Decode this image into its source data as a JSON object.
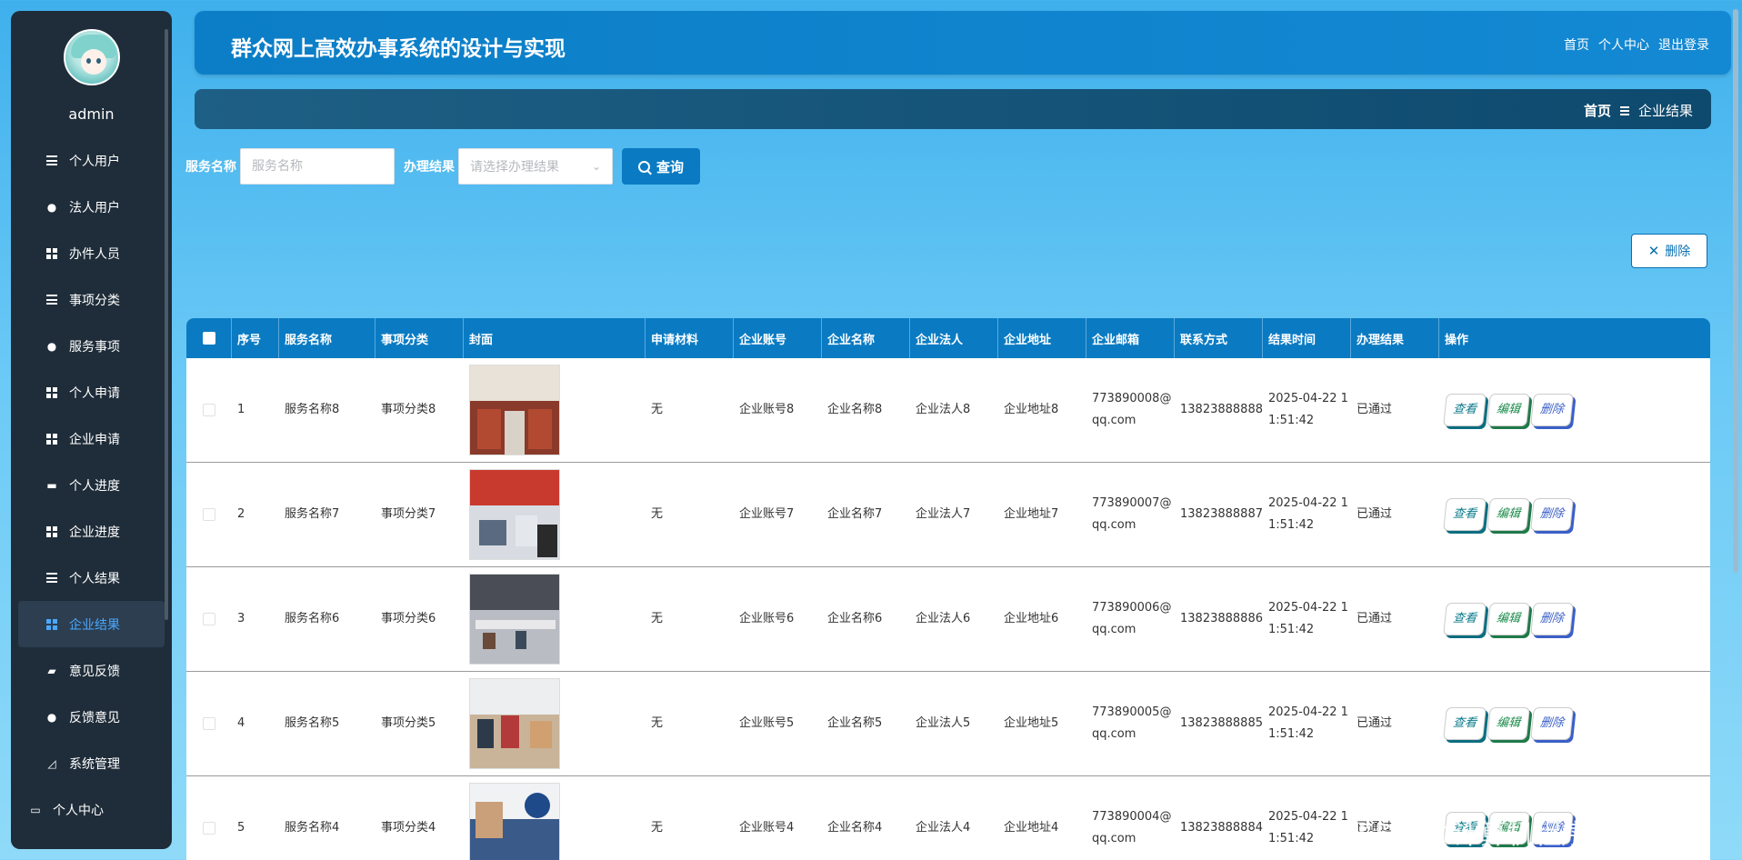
{
  "sidebar": {
    "username": "admin",
    "items": [
      {
        "label": "个人用户",
        "icon": "list-icon"
      },
      {
        "label": "法人用户",
        "icon": "user-icon"
      },
      {
        "label": "办件人员",
        "icon": "grid-icon"
      },
      {
        "label": "事项分类",
        "icon": "sliders-icon"
      },
      {
        "label": "服务事项",
        "icon": "user-icon"
      },
      {
        "label": "个人申请",
        "icon": "grid-icon"
      },
      {
        "label": "企业申请",
        "icon": "grid-icon"
      },
      {
        "label": "个人进度",
        "icon": "print-icon"
      },
      {
        "label": "企业进度",
        "icon": "grid-icon"
      },
      {
        "label": "个人结果",
        "icon": "list-icon"
      },
      {
        "label": "企业结果",
        "icon": "grid-icon"
      },
      {
        "label": "意见反馈",
        "icon": "ticket-icon"
      },
      {
        "label": "反馈意见",
        "icon": "bulb-icon"
      },
      {
        "label": "系统管理",
        "icon": "chart-icon"
      },
      {
        "label": "个人中心",
        "icon": "card-icon"
      }
    ],
    "active_index": 10
  },
  "header": {
    "title": "群众网上高效办事系统的设计与实现",
    "links": [
      "首页",
      "个人中心",
      "退出登录"
    ]
  },
  "breadcrumb": {
    "home": "首页",
    "current": "企业结果"
  },
  "search": {
    "name_label": "服务名称",
    "name_placeholder": "服务名称",
    "result_label": "办理结果",
    "result_placeholder": "请选择办理结果",
    "query_label": "查询"
  },
  "toolbar": {
    "delete_label": "删除"
  },
  "table": {
    "headers": [
      "序号",
      "服务名称",
      "事项分类",
      "封面",
      "申请材料",
      "企业账号",
      "企业名称",
      "企业法人",
      "企业地址",
      "企业邮箱",
      "联系方式",
      "结果时间",
      "办理结果",
      "操作"
    ],
    "rows": [
      {
        "idx": "1",
        "name": "服务名称8",
        "cat": "事项分类8",
        "mat": "无",
        "acct": "企业账号8",
        "cname": "企业名称8",
        "legal": "企业法人8",
        "addr": "企业地址8",
        "mail": "773890008@qq.com",
        "phone": "13823888888",
        "time": "2025-04-22 11:51:42",
        "result": "已通过"
      },
      {
        "idx": "2",
        "name": "服务名称7",
        "cat": "事项分类7",
        "mat": "无",
        "acct": "企业账号7",
        "cname": "企业名称7",
        "legal": "企业法人7",
        "addr": "企业地址7",
        "mail": "773890007@qq.com",
        "phone": "13823888887",
        "time": "2025-04-22 11:51:42",
        "result": "已通过"
      },
      {
        "idx": "3",
        "name": "服务名称6",
        "cat": "事项分类6",
        "mat": "无",
        "acct": "企业账号6",
        "cname": "企业名称6",
        "legal": "企业法人6",
        "addr": "企业地址6",
        "mail": "773890006@qq.com",
        "phone": "13823888886",
        "time": "2025-04-22 11:51:42",
        "result": "已通过"
      },
      {
        "idx": "4",
        "name": "服务名称5",
        "cat": "事项分类5",
        "mat": "无",
        "acct": "企业账号5",
        "cname": "企业名称5",
        "legal": "企业法人5",
        "addr": "企业地址5",
        "mail": "773890005@qq.com",
        "phone": "13823888885",
        "time": "2025-04-22 11:51:42",
        "result": "已通过"
      },
      {
        "idx": "5",
        "name": "服务名称4",
        "cat": "事项分类4",
        "mat": "无",
        "acct": "企业账号4",
        "cname": "企业名称4",
        "legal": "企业法人4",
        "addr": "企业地址4",
        "mail": "773890004@qq.com",
        "phone": "13823888884",
        "time": "2025-04-22 11:51:42",
        "result": "已通过"
      }
    ],
    "ops": {
      "view": "查看",
      "edit": "编辑",
      "delete": "删除"
    }
  },
  "watermark": "CSDN @计算机程序猿学长",
  "colors": {
    "header_bg": "#0b7ec7",
    "sidebar_bg": "#1f2d3a",
    "active_text": "#4aa8ff",
    "table_header_bg": "#0a7bc3"
  }
}
